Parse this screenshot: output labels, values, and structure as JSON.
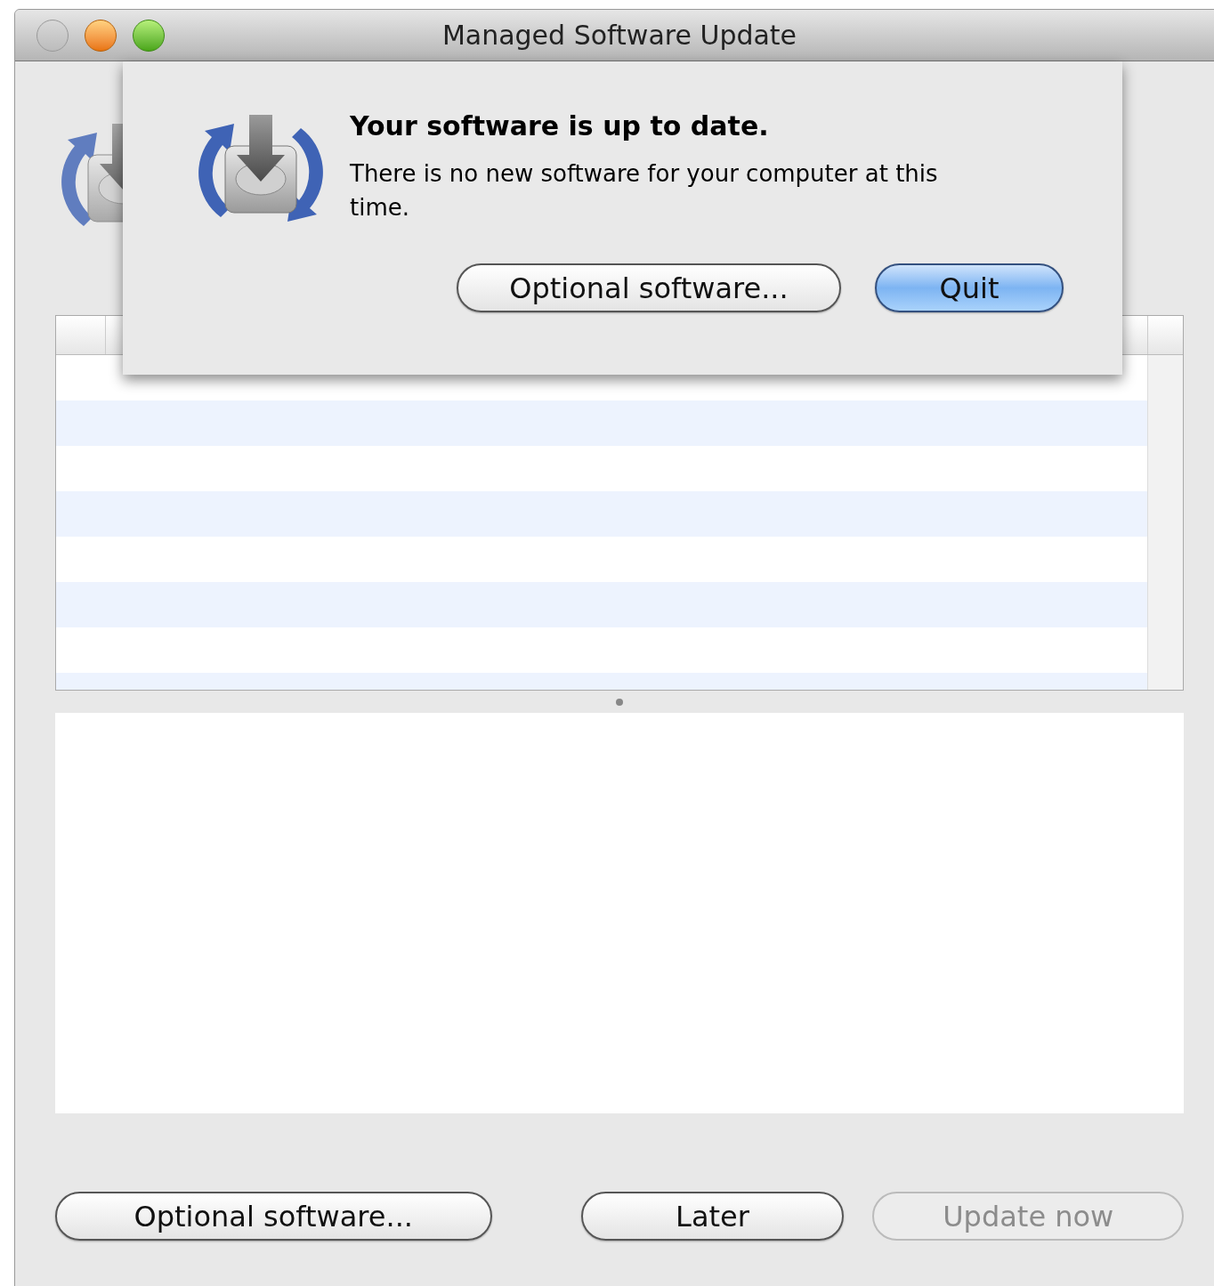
{
  "window": {
    "title": "Managed Software Update"
  },
  "sheet": {
    "title": "Your software is up to date.",
    "message": "There is no new software for your computer at this time.",
    "buttons": [
      {
        "label": "Optional software...",
        "default": false
      },
      {
        "label": "Quit",
        "default": true
      }
    ]
  },
  "buttons": [
    {
      "label": "Optional software...",
      "disabled": false
    },
    {
      "label": "Later",
      "disabled": false
    },
    {
      "label": "Update now",
      "disabled": true
    }
  ]
}
